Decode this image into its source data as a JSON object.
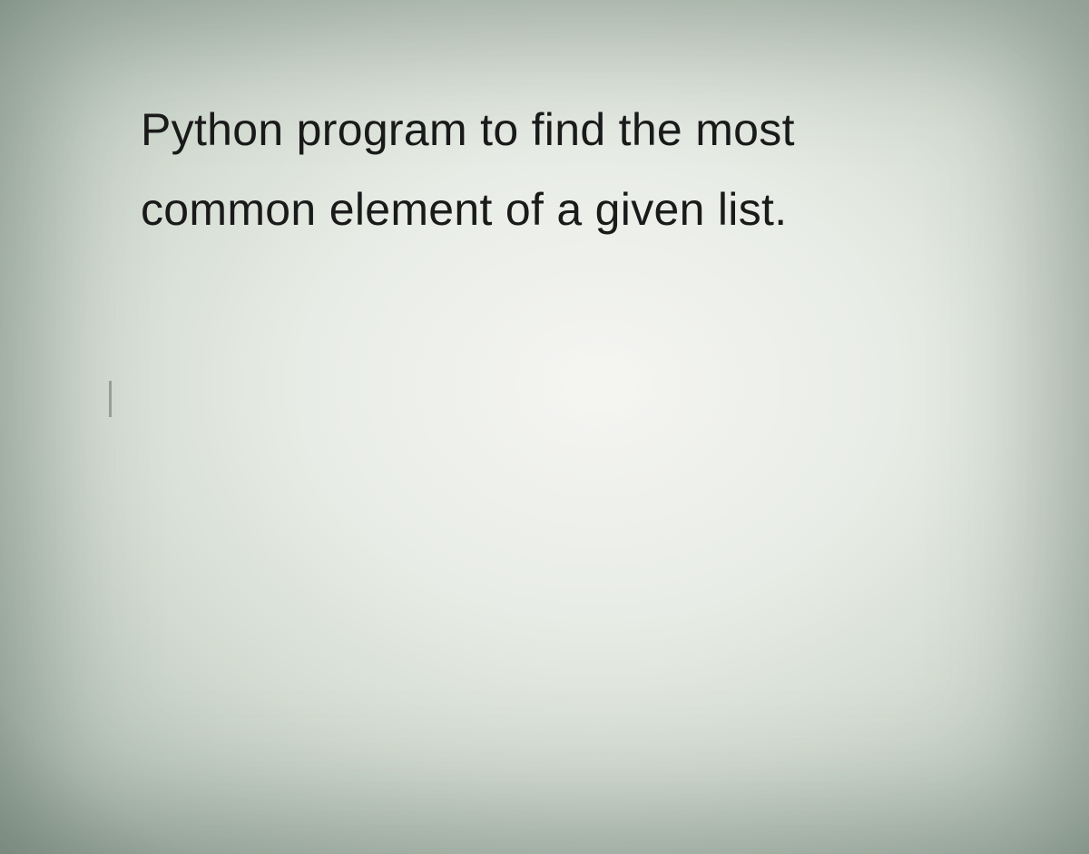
{
  "problem": {
    "line1": "Python program to find the most",
    "line2": "common element of a given list."
  }
}
